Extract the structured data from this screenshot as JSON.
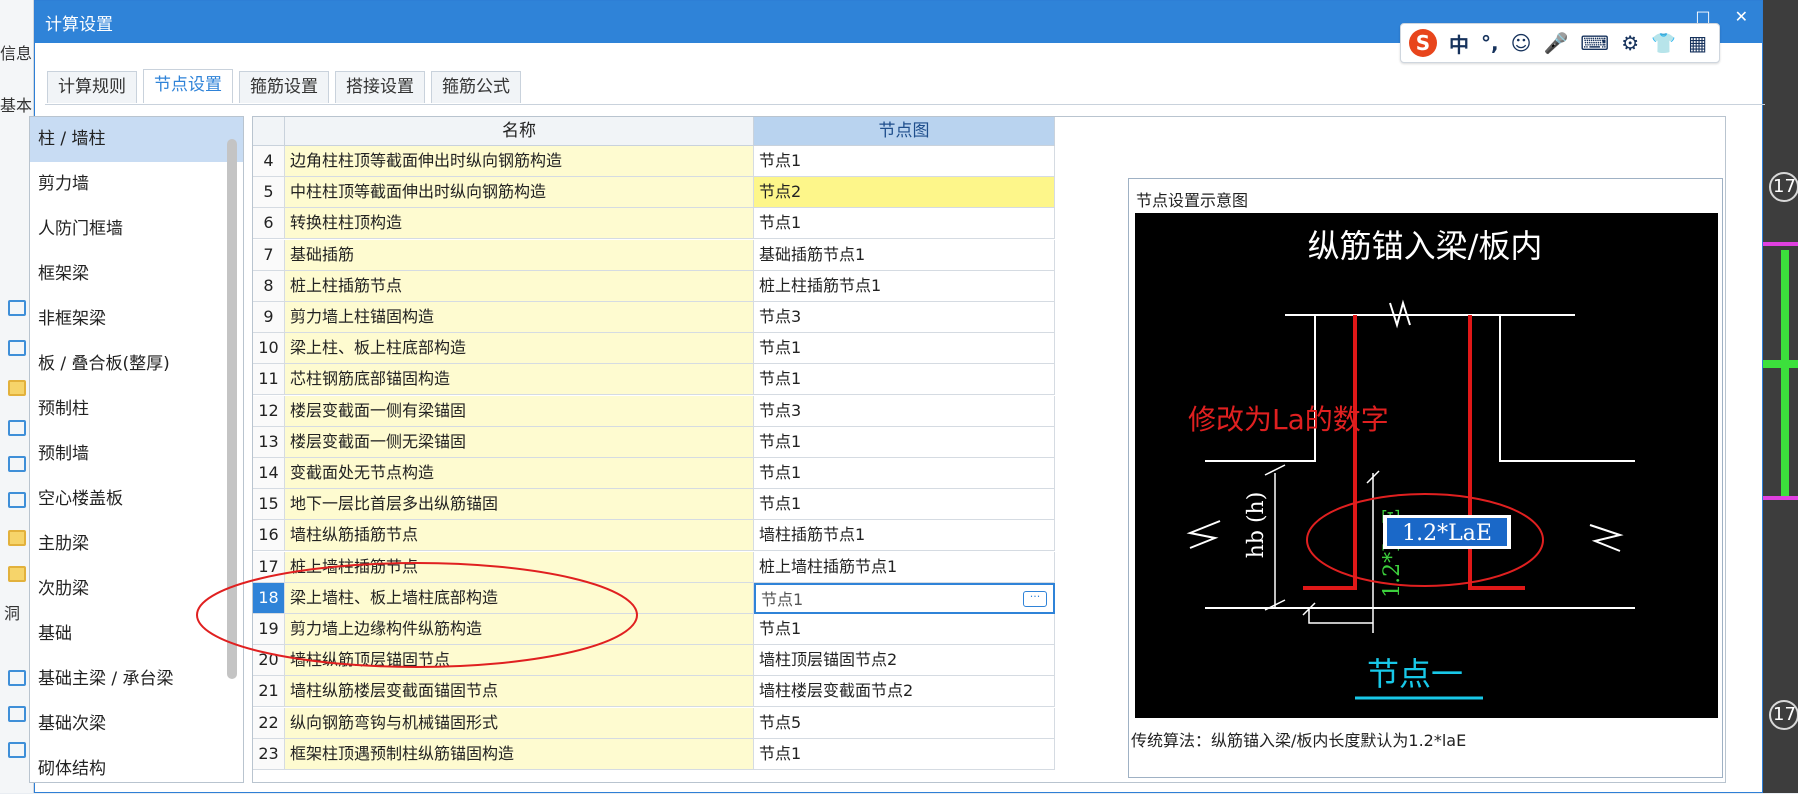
{
  "window": {
    "title": "计算设置"
  },
  "background": {
    "left_labels": [
      "信息",
      "基本",
      "洞"
    ],
    "right_labels": [
      "17",
      "17"
    ]
  },
  "ime": {
    "logo": "S",
    "mode": "中",
    "punct": "°,",
    "emoji": "☺",
    "mic": "🎤",
    "keyboard": "⌨",
    "tools": "⚙",
    "skin": "👕",
    "menu": "▦"
  },
  "tabs": [
    {
      "label": "计算规则"
    },
    {
      "label": "节点设置"
    },
    {
      "label": "箍筋设置"
    },
    {
      "label": "搭接设置"
    },
    {
      "label": "箍筋公式"
    }
  ],
  "categories": [
    "柱 / 墙柱",
    "剪力墙",
    "人防门框墙",
    "框架梁",
    "非框架梁",
    "板 / 叠合板(整厚)",
    "预制柱",
    "预制墙",
    "空心楼盖板",
    "主肋梁",
    "次肋梁",
    "基础",
    "基础主梁 / 承台梁",
    "基础次梁",
    "砌体结构"
  ],
  "grid": {
    "header_name": "名称",
    "header_node": "节点图",
    "rows": [
      {
        "num": "4",
        "name": "边角柱柱顶等截面伸出时纵向钢筋构造",
        "node": "节点1"
      },
      {
        "num": "5",
        "name": "中柱柱顶等截面伸出时纵向钢筋构造",
        "node": "节点2"
      },
      {
        "num": "6",
        "name": "转换柱柱顶构造",
        "node": "节点1"
      },
      {
        "num": "7",
        "name": "基础插筋",
        "node": "基础插筋节点1"
      },
      {
        "num": "8",
        "name": "桩上柱插筋节点",
        "node": "桩上柱插筋节点1"
      },
      {
        "num": "9",
        "name": "剪力墙上柱锚固构造",
        "node": "节点3"
      },
      {
        "num": "10",
        "name": "梁上柱、板上柱底部构造",
        "node": "节点1"
      },
      {
        "num": "11",
        "name": "芯柱钢筋底部锚固构造",
        "node": "节点1"
      },
      {
        "num": "12",
        "name": "楼层变截面一侧有梁锚固",
        "node": "节点3"
      },
      {
        "num": "13",
        "name": "楼层变截面一侧无梁锚固",
        "node": "节点1"
      },
      {
        "num": "14",
        "name": "变截面处无节点构造",
        "node": "节点1"
      },
      {
        "num": "15",
        "name": "地下一层比首层多出纵筋锚固",
        "node": "节点1"
      },
      {
        "num": "16",
        "name": "墙柱纵筋插筋节点",
        "node": "墙柱插筋节点1"
      },
      {
        "num": "17",
        "name": "桩上墙柱插筋节点",
        "node": "桩上墙柱插筋节点1"
      },
      {
        "num": "18",
        "name": "梁上墙柱、板上墙柱底部构造",
        "node": "节点1"
      },
      {
        "num": "19",
        "name": "剪力墙上边缘构件纵筋构造",
        "node": "节点1"
      },
      {
        "num": "20",
        "name": "墙柱纵筋顶层锚固节点",
        "node": "墙柱顶层锚固节点2"
      },
      {
        "num": "21",
        "name": "墙柱纵筋楼层变截面锚固节点",
        "node": "墙柱楼层变截面节点2"
      },
      {
        "num": "22",
        "name": "纵向钢筋弯钩与机械锚固形式",
        "node": "节点5"
      },
      {
        "num": "23",
        "name": "框架柱顶遇预制柱纵筋锚固构造",
        "node": "节点1"
      }
    ],
    "more_label": "···"
  },
  "preview": {
    "title": "节点设置示意图",
    "heading": "纵筋锚入梁/板内",
    "dim_label": "hb (h)",
    "anchor_value": "1.2*LaE",
    "side_label": "1.2*LaE",
    "node_caption": "节点一",
    "description": "传统算法：纵筋锚入梁/板内长度默认为1.2*laE"
  },
  "annotation": {
    "text": "修改为La的数字"
  },
  "colors": {
    "accent": "#2f83d8",
    "name_bg": "#fefbd0",
    "highlight": "#fdf68a",
    "annot": "#e02020"
  }
}
